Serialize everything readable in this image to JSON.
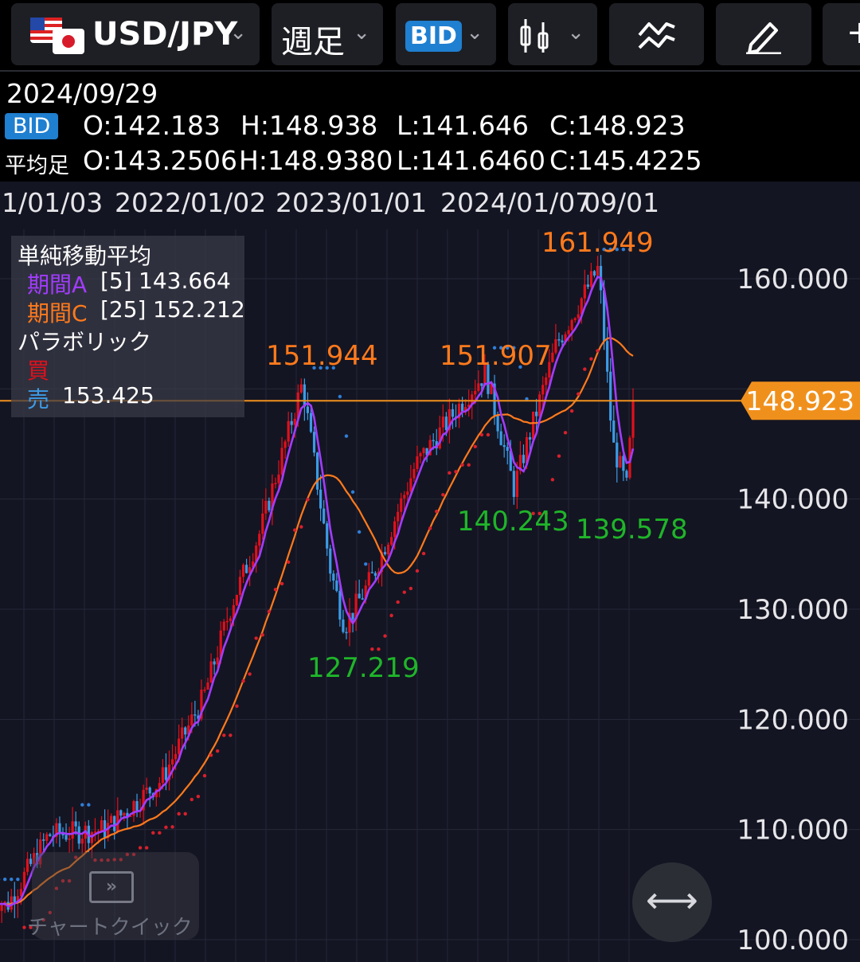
{
  "toolbar": {
    "pair_label": "USD/JPY",
    "period_label": "週足",
    "price_type": "BID",
    "icons": [
      "us-flag-icon",
      "jp-flag-icon",
      "chevron-down-icon",
      "candlestick-icon",
      "indicator-icon",
      "pencil-icon",
      "plus-icon"
    ]
  },
  "info": {
    "date": "2024/09/29",
    "bid_tag": "BID",
    "bid": {
      "o": "O:142.183",
      "h": "H:148.938",
      "l": "L:141.646",
      "c": "C:148.923"
    },
    "avg_label": "平均足",
    "avg": {
      "o": "O:143.2506",
      "h": "H:148.9380",
      "l": "L:141.6460",
      "c": "C:145.4225"
    }
  },
  "legend": {
    "sma_title": "単純移動平均",
    "period_a_label": "期間A",
    "period_a_len": "[5]",
    "period_a_value": "143.664",
    "period_c_label": "期間C",
    "period_c_len": "[25]",
    "period_c_value": "152.212",
    "psar_title": "パラボリック",
    "buy_label": "買",
    "sell_label": "売",
    "sell_value": "153.425"
  },
  "colors": {
    "bull": "#e1101c",
    "bear": "#3c9be6",
    "ma_a": "#a23cff",
    "ma_c": "#ff7a1c",
    "psar_buy": "#d9202c",
    "psar_sell": "#2f7fd8",
    "price_line": "#f0901c",
    "high_label": "#ff7a1c",
    "low_label": "#1fb52a"
  },
  "chart": {
    "x_axis_labels": [
      "1/01/03",
      "2022/01/02",
      "2023/01/01",
      "2024/01/07",
      "09/01"
    ],
    "y_axis_labels": [
      "160.000",
      "140.000",
      "130.000",
      "120.000",
      "110.000",
      "100.000"
    ],
    "current_price": "148.923",
    "annotations": [
      {
        "text": "161.949",
        "kind": "high"
      },
      {
        "text": "151.944",
        "kind": "high"
      },
      {
        "text": "151.907",
        "kind": "high"
      },
      {
        "text": "127.219",
        "kind": "low"
      },
      {
        "text": "140.243",
        "kind": "low"
      },
      {
        "text": "139.578",
        "kind": "low"
      }
    ],
    "quick_chart_label": "チャートクイック"
  },
  "chart_data": {
    "type": "candlestick",
    "title": "USD/JPY",
    "timeframe": "週足",
    "ylim": [
      99.6,
      165
    ],
    "keypoints": [
      [
        "2020-12",
        104.0
      ],
      [
        "2021-01",
        103.0
      ],
      [
        "2021-04",
        109.5
      ],
      [
        "2021-08",
        110.0
      ],
      [
        "2021-12",
        114.5
      ],
      [
        "2022-03",
        122.0
      ],
      [
        "2022-05",
        130.5
      ],
      [
        "2022-07",
        137.0
      ],
      [
        "2022-10",
        150.5
      ],
      [
        "2022-12",
        133.5
      ],
      [
        "2023-01",
        128.5
      ],
      [
        "2023-03",
        133.0
      ],
      [
        "2023-06",
        143.0
      ],
      [
        "2023-10",
        150.0
      ],
      [
        "2023-11",
        151.5
      ],
      [
        "2024-01",
        141.0
      ],
      [
        "2024-04",
        154.0
      ],
      [
        "2024-07",
        161.0
      ],
      [
        "2024-08",
        145.0
      ],
      [
        "2024-09",
        141.0
      ],
      [
        "2024-09-29",
        148.9
      ]
    ],
    "highs": [
      151.944,
      151.907,
      161.949
    ],
    "lows": [
      127.219,
      140.243,
      139.578
    ],
    "current": 148.923,
    "sma_a_period": 5,
    "sma_c_period": 25
  }
}
